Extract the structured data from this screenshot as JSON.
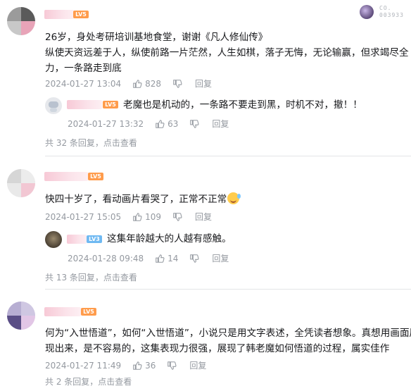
{
  "top_badge": {
    "line1": "CO.",
    "line2": "003933"
  },
  "comments": [
    {
      "level": "LV5",
      "lines": [
        "26岁，身处考研培训基地食堂，谢谢《凡人修仙传》",
        "纵使天资远差于人，纵使前路一片茫然，人生如棋，落子无悔，无论输赢，但求竭尽全",
        "力，一条路走到底"
      ],
      "date": "2024-01-27 13:04",
      "likes": "828",
      "reply_label": "回复",
      "sub_reply": {
        "level": "LV5",
        "text": "老魔也是机动的，一条路不要走到黑，时机不对，撤！！",
        "date": "2024-01-27 13:32",
        "likes": "63",
        "reply_label": "回复"
      },
      "more": {
        "prefix": "共 32 条回复，",
        "link": "点击查看"
      }
    },
    {
      "level": "LV5",
      "lines": [
        "快四十岁了，看动画片看哭了，正常不正常"
      ],
      "date": "2024-01-27 15:05",
      "likes": "109",
      "reply_label": "回复",
      "sub_reply": {
        "level": "LV3",
        "text": "这集年龄越大的人越有感触。",
        "date": "2024-01-28 09:48",
        "likes": "14",
        "reply_label": "回复"
      },
      "more": {
        "prefix": "共 13 条回复，",
        "link": "点击查看"
      }
    },
    {
      "level": "LV5",
      "lines": [
        "何为“入世悟道”，如何“入世悟道”，小说只是用文字表述，全凭读者想象。真想用画面展",
        "现出来，是不容易的，这集表现力很强，展现了韩老魔如何悟道的过程，属实佳作"
      ],
      "date": "2024-01-27 11:49",
      "likes": "36",
      "reply_label": "回复",
      "more": {
        "prefix": "共 2 条回复，",
        "link": "点击查看"
      }
    }
  ],
  "colors": {
    "level5": "#ff9c4c",
    "level3": "#6fb9f2",
    "meta": "#9499a0",
    "text": "#18191c"
  },
  "icons": {
    "like": "thumb-up-icon",
    "dislike": "thumb-down-icon"
  }
}
